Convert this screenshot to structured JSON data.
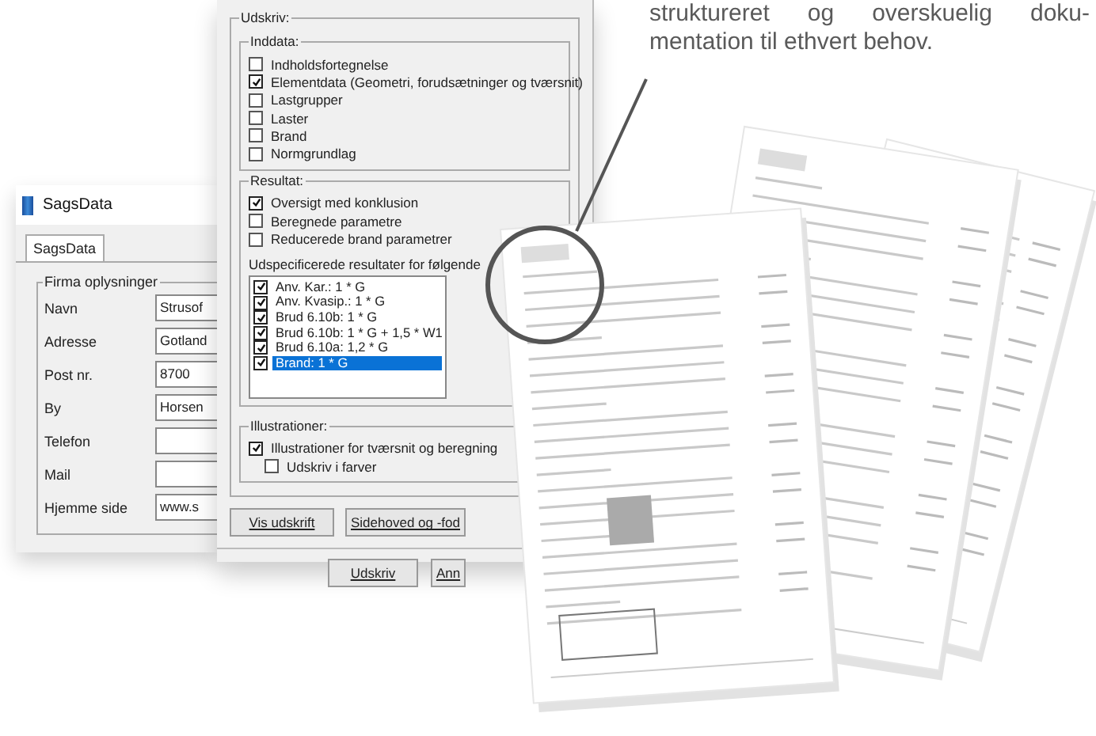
{
  "caption": {
    "lines": [
      "struktureret og overskuelig doku-",
      "mentation til ethvert behov."
    ]
  },
  "sags_window": {
    "title": "SagsData",
    "tabs": [
      {
        "label": "SagsData",
        "selected": true
      }
    ],
    "group": "Firma oplysninger",
    "fields": [
      {
        "label": "Navn",
        "value": "Strusof"
      },
      {
        "label": "Adresse",
        "value": "Gotland"
      },
      {
        "label": "Post nr.",
        "value": "8700"
      },
      {
        "label": "By",
        "value": "Horsen"
      },
      {
        "label": "Telefon"
      },
      {
        "label": "Mail"
      },
      {
        "label": "Hjemme side",
        "value": "www.s"
      }
    ]
  },
  "print_dialog": {
    "group": "Udskriv:",
    "inddata": {
      "title": "Inddata:",
      "items": [
        {
          "label": "Indholdsfortegnelse",
          "checked": false
        },
        {
          "label": "Elementdata (Geometri, forudsætninger og tværsnit)",
          "checked": true
        },
        {
          "label": "Lastgrupper",
          "checked": false
        },
        {
          "label": "Laster",
          "checked": false
        },
        {
          "label": "Brand",
          "checked": false
        },
        {
          "label": "Normgrundlag",
          "checked": false
        }
      ]
    },
    "resultat": {
      "title": "Resultat:",
      "items": [
        {
          "label": "Oversigt med konklusion",
          "checked": true
        },
        {
          "label": "Beregnede parametre",
          "checked": false
        },
        {
          "label": "Reducerede brand parametrer",
          "checked": false
        }
      ],
      "list_label": "Udspecificerede resultater for følgende",
      "list": [
        {
          "label": "Anv. Kar.: 1 * G",
          "checked": true,
          "selected": false
        },
        {
          "label": "Anv. Kvasip.: 1 * G",
          "checked": true,
          "selected": false
        },
        {
          "label": "Brud 6.10b: 1 * G",
          "checked": true,
          "selected": false
        },
        {
          "label": "Brud 6.10b: 1 * G + 1,5 * W1",
          "checked": true,
          "selected": false
        },
        {
          "label": "Brud 6.10a: 1,2 * G",
          "checked": true,
          "selected": false
        },
        {
          "label": "Brand: 1 * G",
          "checked": true,
          "selected": true
        }
      ]
    },
    "illustrationer": {
      "title": "Illustrationer:",
      "items": [
        {
          "label": "Illustrationer for tværsnit og beregning",
          "checked": true,
          "children": [
            {
              "label": "Udskriv i farver",
              "checked": false
            }
          ]
        }
      ]
    },
    "buttons": [
      "Vis udskrift",
      "Sidehoved og -fod"
    ],
    "footer_buttons": [
      "Udskriv",
      "Ann"
    ]
  }
}
